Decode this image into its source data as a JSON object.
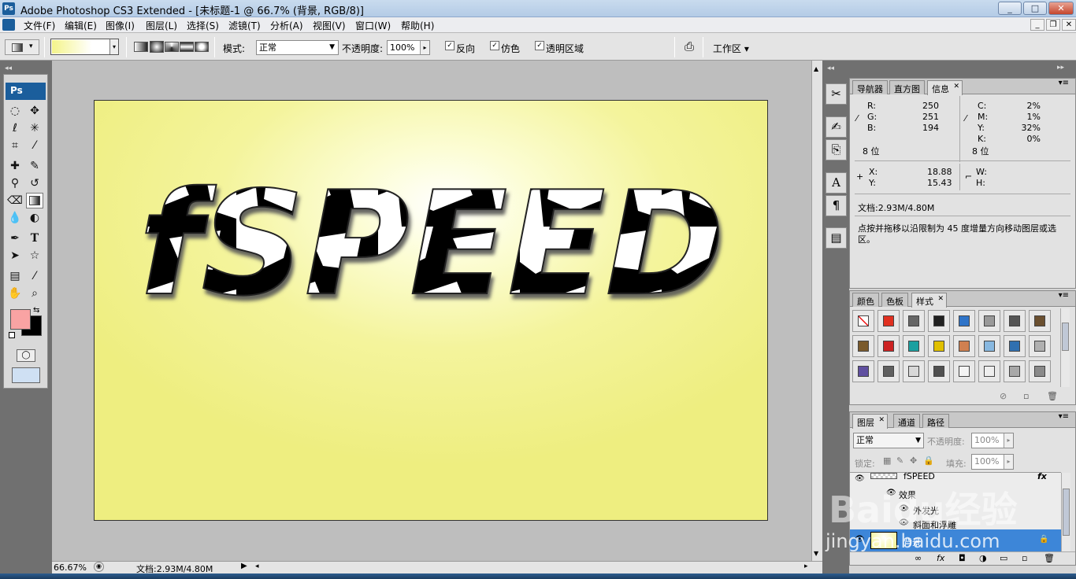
{
  "window": {
    "title": "Adobe Photoshop CS3 Extended - [未标题-1 @ 66.7% (背景, RGB/8)]",
    "min_label": "_",
    "max_label": "□",
    "close_label": "✕",
    "doc_min_label": "_",
    "doc_restore_label": "❐",
    "doc_close_label": "✕"
  },
  "menu": [
    "文件(F)",
    "编辑(E)",
    "图像(I)",
    "图层(L)",
    "选择(S)",
    "滤镜(T)",
    "分析(A)",
    "视图(V)",
    "窗口(W)",
    "帮助(H)"
  ],
  "options": {
    "mode_label": "模式:",
    "mode_value": "正常",
    "opacity_label": "不透明度:",
    "opacity_value": "100%",
    "reverse_label": "反向",
    "dither_label": "仿色",
    "transparency_label": "透明区域",
    "workspace_label": "工作区 ▾",
    "gradient_colors": [
      "#f4f48a",
      "#ffffff"
    ]
  },
  "canvas": {
    "text": "fSPEED",
    "bg_color": "#f0f08a"
  },
  "status": {
    "zoom": "66.67%",
    "doc": "文档:2.93M/4.80M"
  },
  "info_panel": {
    "tabs": [
      "导航器",
      "直方图",
      "信息"
    ],
    "rgb": [
      {
        "k": "R:",
        "v": "250"
      },
      {
        "k": "G:",
        "v": "251"
      },
      {
        "k": "B:",
        "v": "194"
      }
    ],
    "cmyk": [
      {
        "k": "C:",
        "v": "2%"
      },
      {
        "k": "M:",
        "v": "1%"
      },
      {
        "k": "Y:",
        "v": "32%"
      },
      {
        "k": "K:",
        "v": "0%"
      }
    ],
    "bits_left": "8 位",
    "bits_right": "8 位",
    "x_label": "X:",
    "x_value": "18.88",
    "y_label": "Y:",
    "y_value": "15.43",
    "w_label": "W:",
    "h_label": "H:",
    "doc": "文档:2.93M/4.80M",
    "hint": "点按并拖移以沿限制为 45 度增量方向移动图层或选区。"
  },
  "styles_panel": {
    "tabs": [
      "颜色",
      "色板",
      "样式"
    ],
    "swatches": [
      "#ffffff",
      "#e03020",
      "#666666",
      "#222222",
      "#2f74c8",
      "#999999",
      "#555555",
      "#6b5030",
      "#7a5a2c",
      "#cc2222",
      "#1ba0a0",
      "#e0c000",
      "#d08050",
      "#88b8e0",
      "#3070b0",
      "#b0b0b0",
      "#6050a0",
      "#606060",
      "#d8d8d8",
      "#505050",
      "#f4f4f4",
      "#eeeeee",
      "#a8a8a8",
      "#8a8a8a"
    ]
  },
  "layers_panel": {
    "tabs": [
      "图层",
      "通道",
      "路径"
    ],
    "blend": "正常",
    "opacity_label": "不透明度:",
    "opacity_value": "100%",
    "lock_label": "锁定:",
    "fill_label": "填充:",
    "fill_value": "100%",
    "layer1_name": "fSPEED",
    "effects_label": "效果",
    "effect1": "外发光",
    "effect2": "斜面和浮雕",
    "bg_name": "背景"
  },
  "watermark": {
    "brand": "Baidu经验",
    "url": "jingyan.baidu.com"
  }
}
